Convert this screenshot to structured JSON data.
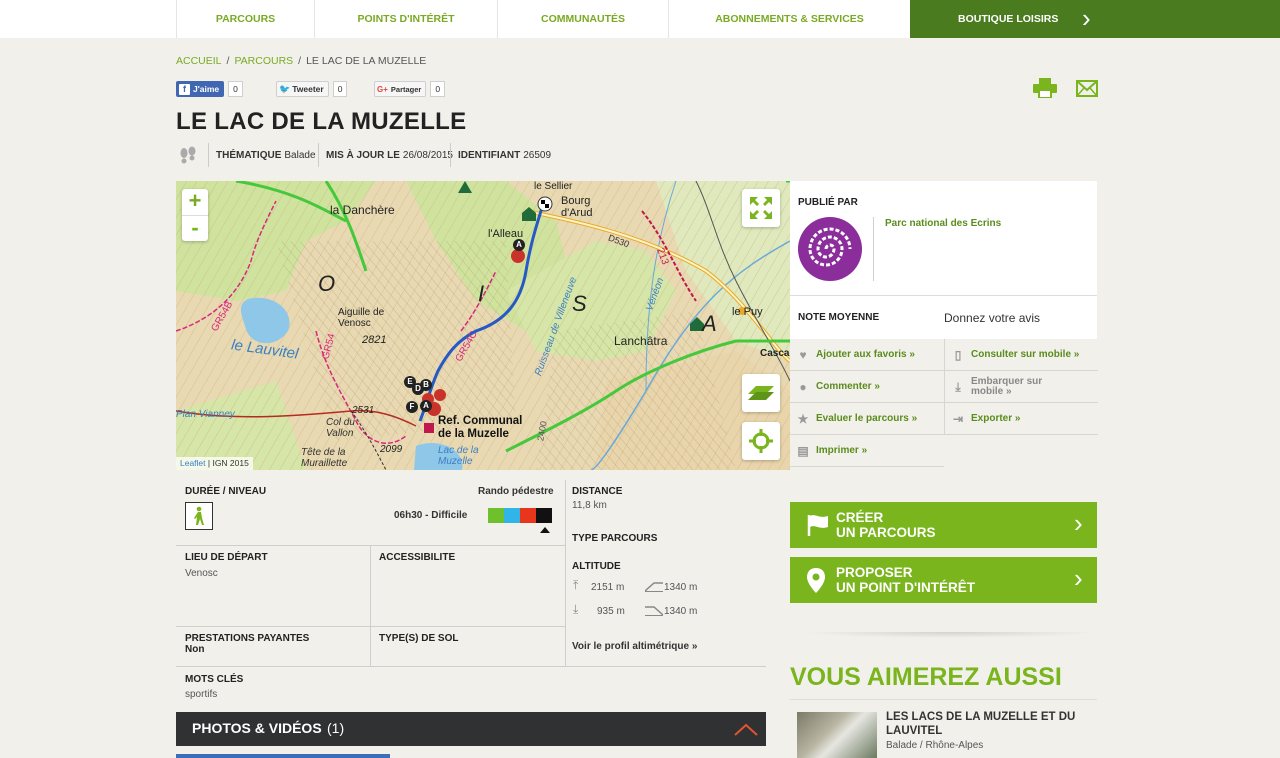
{
  "nav": {
    "items": [
      "PARCOURS",
      "POINTS D'INTÉRÊT",
      "COMMUNAUTÉS",
      "ABONNEMENTS & SERVICES"
    ],
    "shop": "BOUTIQUE LOISIRS"
  },
  "breadcrumb": {
    "home": "ACCUEIL",
    "section": "PARCOURS",
    "current": "LE LAC DE LA MUZELLE",
    "sep": "/"
  },
  "social": {
    "like": "J'aime",
    "like_count": "0",
    "tweet": "Tweeter",
    "tweet_count": "0",
    "share": "Partager",
    "share_count": "0"
  },
  "title": "LE LAC DE LA MUZELLE",
  "meta": {
    "theme_label": "THÉMATIQUE",
    "theme_value": "Balade",
    "updated_label": "MIS À JOUR LE",
    "updated_value": "26/08/2015",
    "id_label": "IDENTIFIANT",
    "id_value": "26509"
  },
  "map": {
    "attribution_link": "Leaflet",
    "attribution_rest": " | IGN 2015",
    "labels": {
      "la_danchere": "la Danchère",
      "lalleau": "l'Alleau",
      "le_sellier": "le Sellier",
      "bourg_darud": "Bourg d'Arud",
      "d530": "D530",
      "le_puy": "le Puy",
      "cascade": "Cascad",
      "lanchatra": "Lanchâtra",
      "aiguille": "Aiguille de Venosc",
      "alt2821": "2821",
      "le_lauvitel": "le Lauvitel",
      "gr54": "GR54",
      "gr54c": "GR54C",
      "gr54b": "GR54B",
      "alt2531": "2531",
      "alt2099": "2099",
      "col_vallon": "Col du Vallon",
      "tete_muraillette": "Tête de la Muraillette",
      "refuge": "Ref. Communal de la Muzelle",
      "lac_muzelle": "Lac de la Muzelle",
      "plan_vianney": "Plan Vianney",
      "big_o": "O",
      "big_i": "I",
      "big_s": "S",
      "big_a": "A",
      "ruisseau": "Ruisseau de Villeneuve",
      "veneon": "Vénéon",
      "alt_2400": "2400",
      "route_213": "213"
    },
    "markers": [
      "A",
      "A",
      "B",
      "D",
      "E",
      "F"
    ]
  },
  "publisher": {
    "label": "PUBLIÉ PAR",
    "name": "Parc national des Ecrins"
  },
  "rating": {
    "label": "NOTE MOYENNE",
    "cta": "Donnez votre avis"
  },
  "actions": [
    {
      "label": "Ajouter aux favoris »",
      "icon": "heart-icon"
    },
    {
      "label": "Consulter sur mobile »",
      "icon": "mobile-icon"
    },
    {
      "label": "Commenter »",
      "icon": "comment-icon"
    },
    {
      "label": "Embarquer sur mobile »",
      "icon": "download-icon"
    },
    {
      "label": "Evaluer le parcours »",
      "icon": "star-icon"
    },
    {
      "label": "Exporter »",
      "icon": "export-icon"
    },
    {
      "label": "Imprimer »",
      "icon": "print-icon"
    }
  ],
  "cta": {
    "create_line1": "CRÉER",
    "create_line2": "UN PARCOURS",
    "propose_line1": "PROPOSER",
    "propose_line2": "UN POINT D'INTÉRÊT"
  },
  "info": {
    "duration_label": "DURÉE / NIVEAU",
    "activity": "Rando pédestre",
    "duration_value": "06h30 - Difficile",
    "level_colors": [
      "#6ec12d",
      "#31b4e8",
      "#e8361c",
      "#111111"
    ],
    "distance_label": "DISTANCE",
    "distance_value": "11,8 km",
    "type_label": "TYPE PARCOURS",
    "altitude_label": "ALTITUDE",
    "alt_max": "2151 m",
    "alt_min": "935 m",
    "ascent": "1340 m",
    "descent": "1340 m",
    "profile_link": "Voir le profil altimétrique »",
    "start_label": "LIEU DE DÉPART",
    "start_value": "Venosc",
    "access_label": "ACCESSIBILITE",
    "paid_label": "PRESTATIONS PAYANTES",
    "paid_value": "Non",
    "ground_label": "TYPE(S) DE SOL",
    "keywords_label": "MOTS CLÉS",
    "keywords_value": "sportifs"
  },
  "photos": {
    "label": "PHOTOS & VIDÉOS",
    "count": "(1)"
  },
  "also": {
    "heading": "VOUS AIMEREZ AUSSI",
    "item_title": "LES LACS DE LA MUZELLE ET DU LAUVITEL",
    "item_meta": "Balade / Rhône-Alpes"
  },
  "colors": {
    "green": "#7ab51d",
    "dark_green": "#4a7b1e",
    "text_green": "#5b8c1c"
  }
}
